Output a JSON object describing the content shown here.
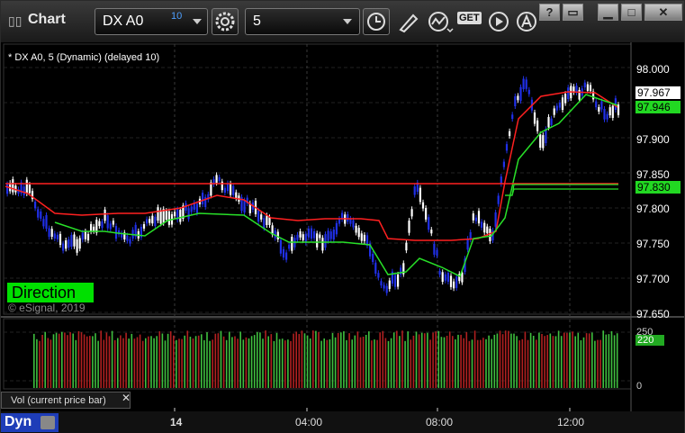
{
  "window": {
    "title": "Chart",
    "grip_glyph": "▯▯"
  },
  "toolbar": {
    "symbol": "DX A0",
    "symbol_superscript": "10",
    "interval": "5",
    "icons": [
      "settings-gear-icon",
      "clock-icon",
      "pencil-draw-icon",
      "study-line-icon",
      "get-data-icon",
      "play-icon",
      "alert-icon"
    ],
    "get_label": "GET"
  },
  "window_controls": {
    "help": "?",
    "link": "▭",
    "minimize": "▁",
    "maximize": "□",
    "close": "✕"
  },
  "chart": {
    "header": "* DX A0, 5 (Dynamic) (delayed 10)",
    "copyright": "© eSignal, 2019",
    "direction_label": "Direction",
    "price_axis": [
      "98.000",
      "97.950",
      "97.900",
      "97.850",
      "97.800",
      "97.750",
      "97.700",
      "97.650"
    ],
    "price_label_last": "97.967",
    "price_label_green1": "97.946",
    "price_label_green2": "97.830",
    "volume_axis": [
      "250",
      "220",
      "0"
    ],
    "volume_label": "Vol (current price bar)",
    "volume_close": "✕",
    "time_axis": [
      "14",
      "04:00",
      "08:00",
      "12:00"
    ],
    "dyn_label": "Dyn",
    "colors": {
      "up": "#ffffff",
      "down": "#2030e8",
      "red_line": "#ff2020",
      "green_line": "#28e028",
      "vol_up": "#3fbf3f",
      "vol_down": "#b02020"
    }
  }
}
